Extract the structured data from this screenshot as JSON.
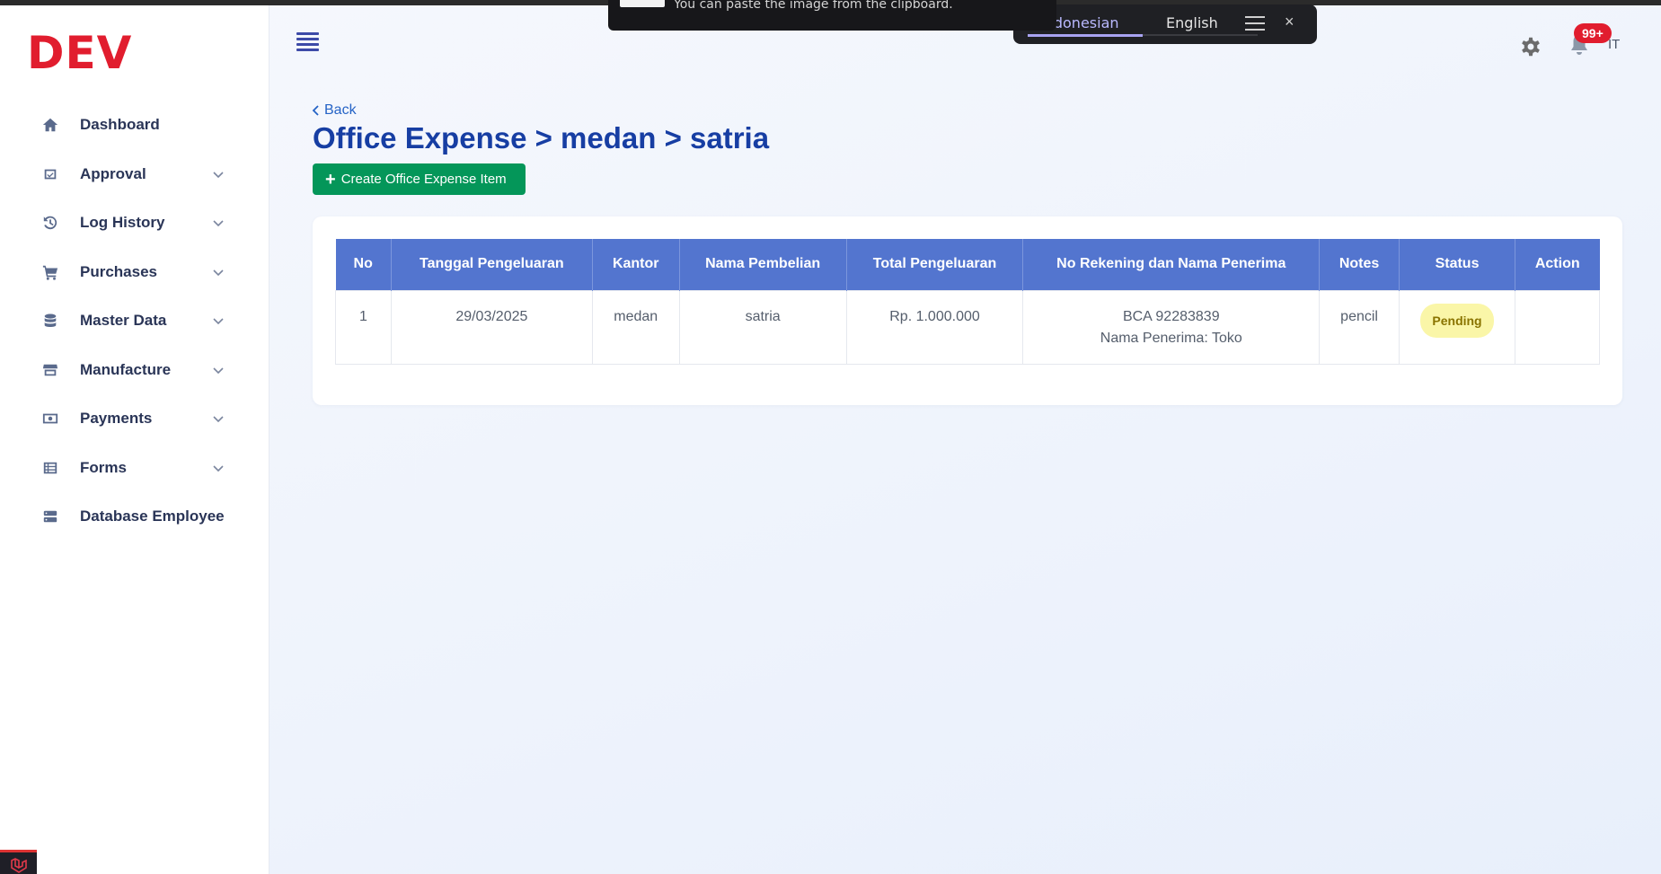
{
  "app": {
    "logo": "DEV"
  },
  "sidebar": {
    "items": [
      {
        "label": "Dashboard",
        "icon": "home-icon",
        "chevron": false
      },
      {
        "label": "Approval",
        "icon": "approval-icon",
        "chevron": true
      },
      {
        "label": "Log History",
        "icon": "history-icon",
        "chevron": true
      },
      {
        "label": "Purchases",
        "icon": "cart-icon",
        "chevron": true
      },
      {
        "label": "Master Data",
        "icon": "database-icon",
        "chevron": true
      },
      {
        "label": "Manufacture",
        "icon": "store-icon",
        "chevron": true
      },
      {
        "label": "Payments",
        "icon": "money-icon",
        "chevron": true
      },
      {
        "label": "Forms",
        "icon": "list-icon",
        "chevron": true
      },
      {
        "label": "Database Employee",
        "icon": "server-icon",
        "chevron": false
      }
    ]
  },
  "toast": {
    "text": "You can paste the image from the clipboard."
  },
  "translate": {
    "lang_active": "Indonesian",
    "lang_other": "English",
    "close": "×"
  },
  "header": {
    "notification_count": "99+",
    "user_initials": "IT"
  },
  "page": {
    "back_label": "Back",
    "title": "Office Expense > medan > satria",
    "create_button": "Create Office Expense Item"
  },
  "table": {
    "columns": [
      "No",
      "Tanggal Pengeluaran",
      "Kantor",
      "Nama Pembelian",
      "Total Pengeluaran",
      "No Rekening dan Nama Penerima",
      "Notes",
      "Status",
      "Action"
    ],
    "rows": [
      {
        "no": "1",
        "tanggal": "29/03/2025",
        "kantor": "medan",
        "nama_pembelian": "satria",
        "total": "Rp. 1.000.000",
        "rekening": "BCA 92283839",
        "penerima": "Nama Penerima: Toko",
        "notes": "pencil",
        "status": "Pending",
        "action": ""
      }
    ]
  },
  "colors": {
    "accent": "#173ea3",
    "table_header": "#5375cf",
    "create_button": "#049659",
    "logo": "#e11d2e",
    "status_pending_bg": "#faf6a8"
  }
}
